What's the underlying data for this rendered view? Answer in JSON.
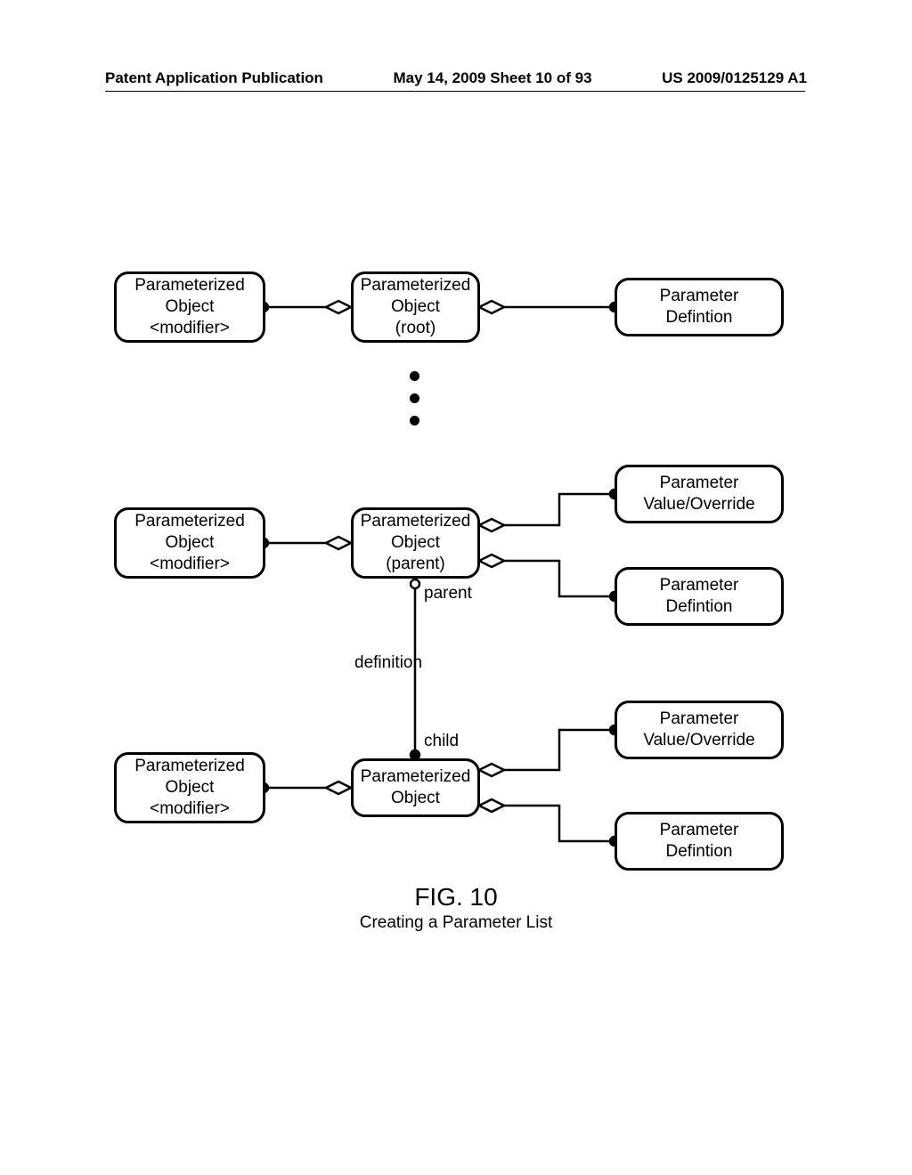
{
  "header": {
    "left": "Patent Application Publication",
    "center": "May 14, 2009  Sheet 10 of 93",
    "right": "US 2009/0125129 A1"
  },
  "diagram": {
    "boxes": {
      "r1_left": {
        "line1": "Parameterized",
        "line2": "Object",
        "line3": "<modifier>"
      },
      "r1_mid": {
        "line1": "Parameterized",
        "line2": "Object",
        "line3": "(root)"
      },
      "r1_right": {
        "line1": "Parameter",
        "line2": "Defintion"
      },
      "r2_left": {
        "line1": "Parameterized",
        "line2": "Object",
        "line3": "<modifier>"
      },
      "r2_mid": {
        "line1": "Parameterized",
        "line2": "Object",
        "line3": "(parent)"
      },
      "r2_r1": {
        "line1": "Parameter",
        "line2": "Value/Override"
      },
      "r2_r2": {
        "line1": "Parameter",
        "line2": "Defintion"
      },
      "r3_left": {
        "line1": "Parameterized",
        "line2": "Object",
        "line3": "<modifier>"
      },
      "r3_mid": {
        "line1": "Parameterized",
        "line2": "Object"
      },
      "r3_r1": {
        "line1": "Parameter",
        "line2": "Value/Override"
      },
      "r3_r2": {
        "line1": "Parameter",
        "line2": "Defintion"
      }
    },
    "labels": {
      "parent": "parent",
      "definition": "definition",
      "child": "child"
    },
    "figure": {
      "title": "FIG. 10",
      "subtitle": "Creating a Parameter List"
    }
  }
}
